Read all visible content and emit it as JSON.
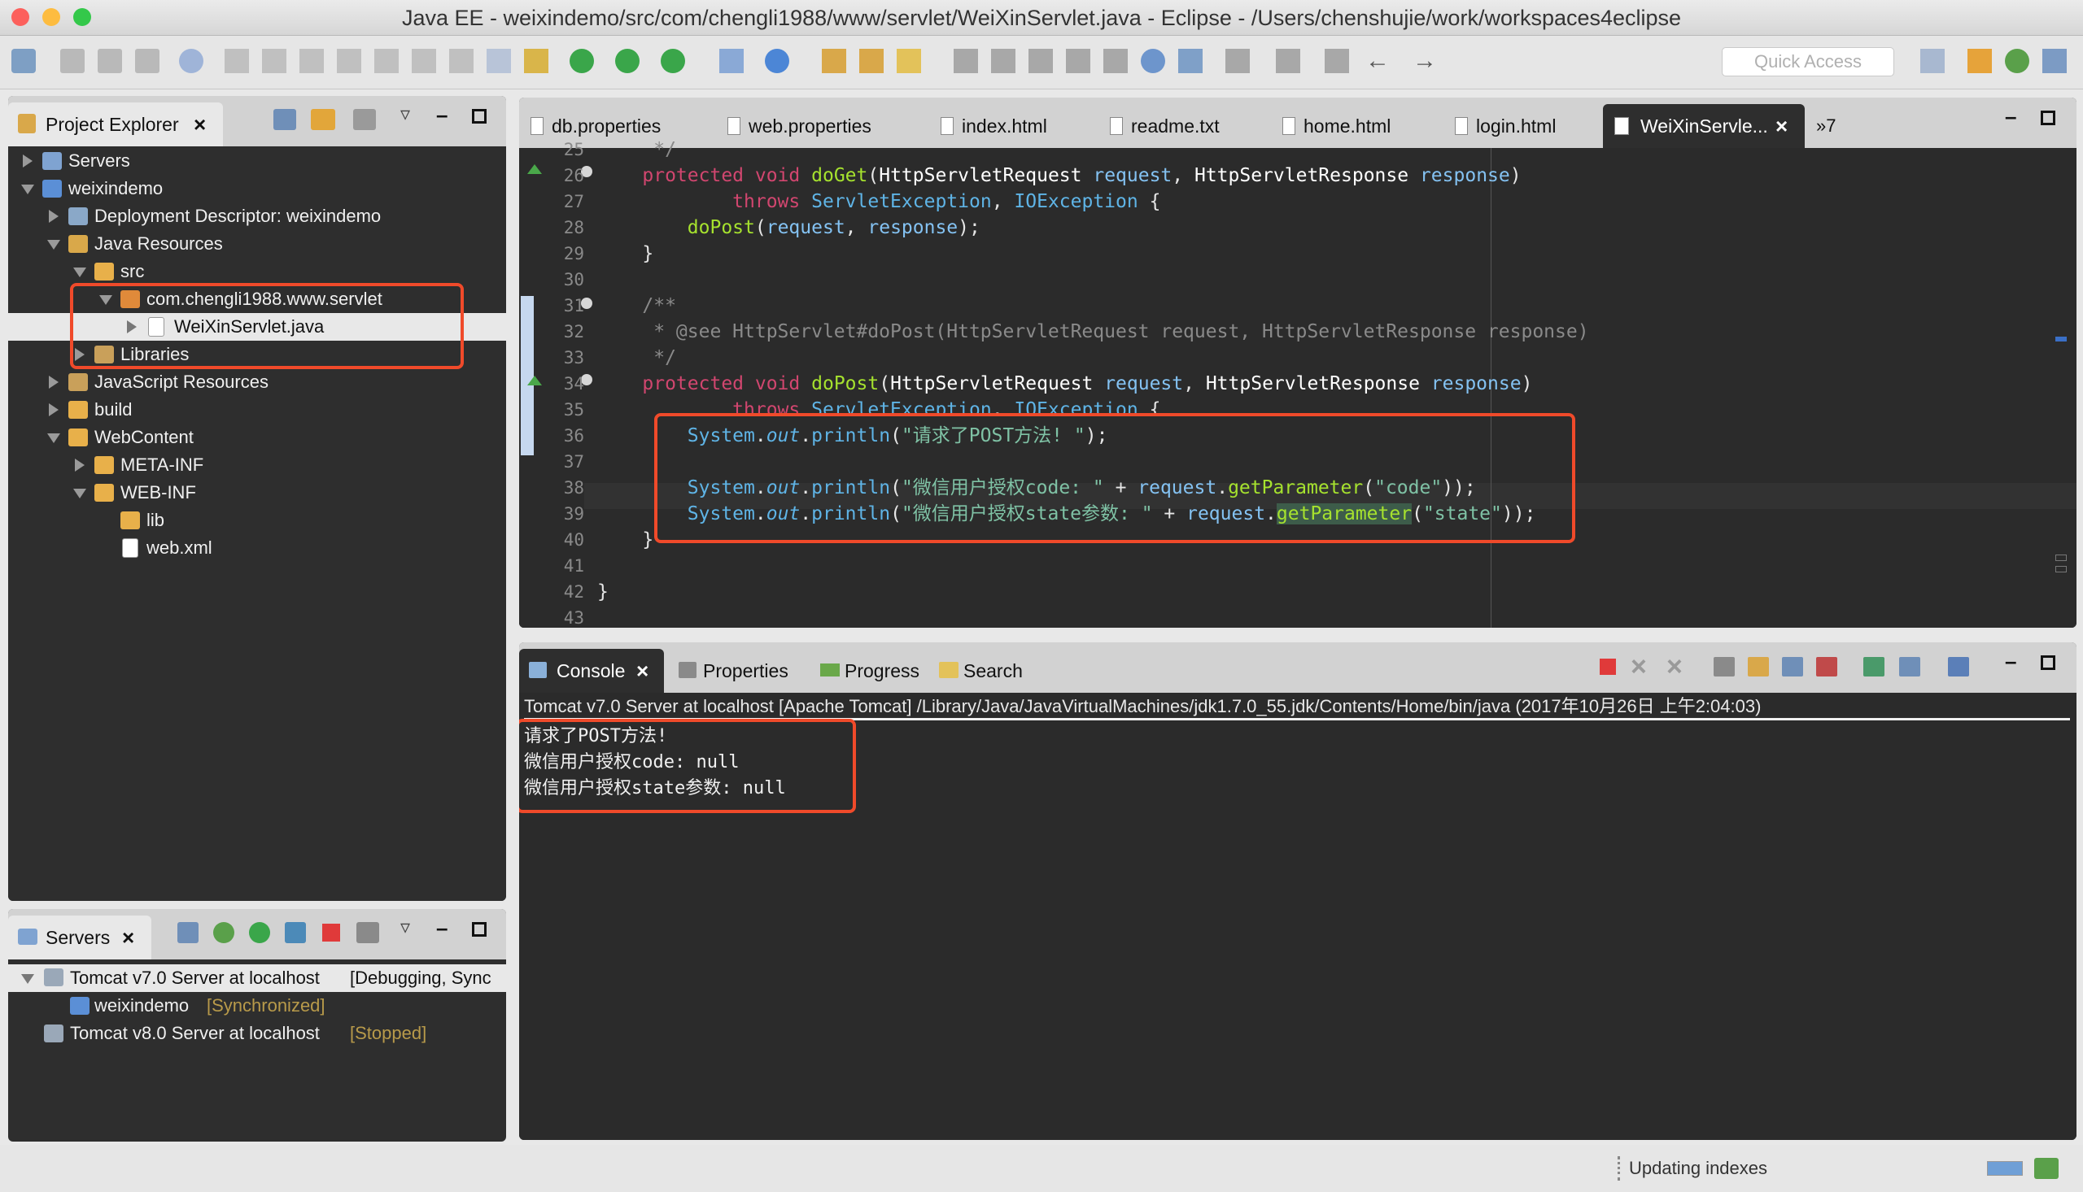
{
  "window": {
    "title": "Java EE - weixindemo/src/com/chengli1988/www/servlet/WeiXinServlet.java - Eclipse - /Users/chenshujie/work/workspaces4eclipse"
  },
  "toolbar": {
    "quick_access_placeholder": "Quick Access"
  },
  "project_explorer": {
    "tab_label": "Project Explorer",
    "items": [
      {
        "label": "Servers"
      },
      {
        "label": "weixindemo"
      },
      {
        "label": "Deployment Descriptor: weixindemo"
      },
      {
        "label": "Java Resources"
      },
      {
        "label": "src"
      },
      {
        "label": "com.chengli1988.www.servlet"
      },
      {
        "label": "WeiXinServlet.java"
      },
      {
        "label": "Libraries"
      },
      {
        "label": "JavaScript Resources"
      },
      {
        "label": "build"
      },
      {
        "label": "WebContent"
      },
      {
        "label": "META-INF"
      },
      {
        "label": "WEB-INF"
      },
      {
        "label": "lib"
      },
      {
        "label": "web.xml"
      }
    ]
  },
  "servers_view": {
    "tab_label": "Servers",
    "rows": [
      {
        "name": "Tomcat v7.0 Server at localhost",
        "state": "[Debugging, Sync"
      },
      {
        "name": "weixindemo",
        "state": "[Synchronized]"
      },
      {
        "name": "Tomcat v8.0 Server at localhost",
        "state": "[Stopped]"
      }
    ]
  },
  "editor": {
    "tabs": [
      {
        "label": "db.properties"
      },
      {
        "label": "web.properties"
      },
      {
        "label": "index.html"
      },
      {
        "label": "readme.txt"
      },
      {
        "label": "home.html"
      },
      {
        "label": "login.html"
      },
      {
        "label": "WeiXinServle..."
      }
    ],
    "overflow_label": "»7",
    "line_numbers": [
      "25",
      "26",
      "27",
      "28",
      "29",
      "30",
      "31",
      "32",
      "33",
      "34",
      "35",
      "36",
      "37",
      "38",
      "39",
      "40",
      "41",
      "42",
      "43"
    ]
  },
  "console": {
    "tabs": [
      {
        "label": "Console"
      },
      {
        "label": "Properties"
      },
      {
        "label": "Progress"
      },
      {
        "label": "Search"
      }
    ],
    "header": "Tomcat v7.0 Server at localhost [Apache Tomcat] /Library/Java/JavaVirtualMachines/jdk1.7.0_55.jdk/Contents/Home/bin/java (2017年10月26日 上午2:04:03)",
    "lines": [
      "请求了POST方法!",
      "微信用户授权code: null",
      "微信用户授权state参数: null"
    ]
  },
  "status_bar": {
    "text": "Updating indexes"
  },
  "colors": {
    "highlight_box": "#f04a2a",
    "editor_bg": "#2b2b2b",
    "keyword": "#d1466f",
    "method": "#a6e22e",
    "type": "#5fb4e6",
    "string": "#7fc2a5"
  }
}
